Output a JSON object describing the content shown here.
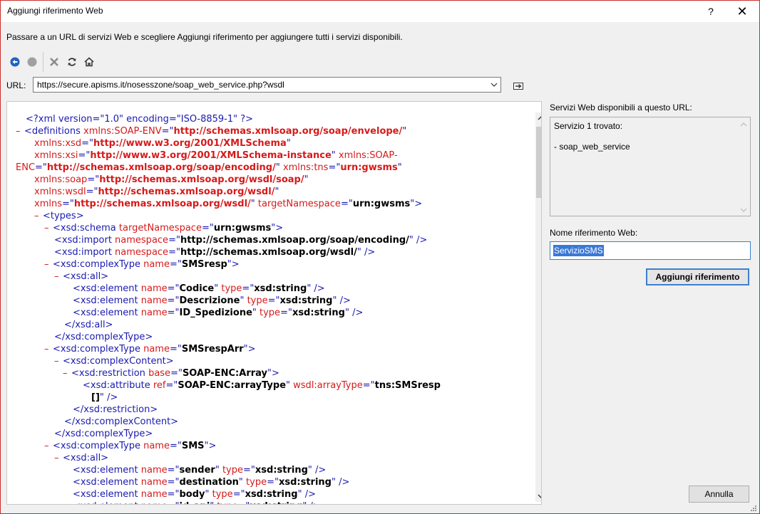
{
  "window": {
    "title": "Aggiungi riferimento Web",
    "help": "?",
    "close": "✕"
  },
  "instruction": "Passare a un URL di servizi Web e scegliere Aggiungi riferimento per aggiungere tutti i servizi disponibili.",
  "toolbar": {
    "icons": [
      "back-icon",
      "stop-icon",
      "cancel-icon",
      "refresh-icon",
      "home-icon"
    ]
  },
  "url": {
    "label": "URL:",
    "value": "https://secure.apisms.it/nosesszone/soap_web_service.php?wsdl"
  },
  "services": {
    "label": "Servizi Web disponibili a questo URL:",
    "found": "Servizio 1 trovato:",
    "items": [
      "- soap_web_service"
    ]
  },
  "reference": {
    "label": "Nome riferimento Web:",
    "value": "ServizioSMS"
  },
  "buttons": {
    "add": "Aggiungi riferimento",
    "cancel": "Annulla"
  },
  "xml": {
    "lines": [
      [
        [
          "t",
          "<?xml version=\"1.0\" encoding=\"ISO-8859-1\" ?>"
        ]
      ],
      [
        [
          "m",
          "–"
        ],
        [
          "t",
          "<definitions "
        ],
        [
          "an",
          "xmlns:SOAP-ENV"
        ],
        [
          "t",
          "=\""
        ],
        [
          "rv",
          "http://schemas.xmlsoap.org/soap/envelope/"
        ],
        [
          "t",
          "\""
        ]
      ],
      [
        [
          "an",
          "xmlns:xsd"
        ],
        [
          "t",
          "=\""
        ],
        [
          "rv",
          "http://www.w3.org/2001/XMLSchema"
        ],
        [
          "t",
          "\""
        ]
      ],
      [
        [
          "an",
          "xmlns:xsi"
        ],
        [
          "t",
          "=\""
        ],
        [
          "rv",
          "http://www.w3.org/2001/XMLSchema-instance"
        ],
        [
          "t",
          "\" "
        ],
        [
          "an",
          "xmlns:SOAP-"
        ]
      ],
      [
        [
          "an",
          "ENC"
        ],
        [
          "t",
          "=\""
        ],
        [
          "rv",
          "http://schemas.xmlsoap.org/soap/encoding/"
        ],
        [
          "t",
          "\" "
        ],
        [
          "an",
          "xmlns:tns"
        ],
        [
          "t",
          "=\""
        ],
        [
          "rv",
          "urn:gwsms"
        ],
        [
          "t",
          "\""
        ]
      ],
      [
        [
          "an",
          "xmlns:soap"
        ],
        [
          "t",
          "=\""
        ],
        [
          "rv",
          "http://schemas.xmlsoap.org/wsdl/soap/"
        ],
        [
          "t",
          "\""
        ]
      ],
      [
        [
          "an",
          "xmlns:wsdl"
        ],
        [
          "t",
          "=\""
        ],
        [
          "rv",
          "http://schemas.xmlsoap.org/wsdl/"
        ],
        [
          "t",
          "\""
        ]
      ],
      [
        [
          "an",
          "xmlns"
        ],
        [
          "t",
          "=\""
        ],
        [
          "rv",
          "http://schemas.xmlsoap.org/wsdl/"
        ],
        [
          "t",
          "\" "
        ],
        [
          "an",
          "targetNamespace"
        ],
        [
          "t",
          "=\""
        ],
        [
          "av",
          "urn:gwsms"
        ],
        [
          "t",
          "\">"
        ]
      ],
      [
        [
          "m",
          "–"
        ],
        [
          "t",
          "<types>"
        ]
      ],
      [
        [
          "m",
          "–"
        ],
        [
          "t",
          "<xsd:schema "
        ],
        [
          "an",
          "targetNamespace"
        ],
        [
          "t",
          "=\""
        ],
        [
          "av",
          "urn:gwsms"
        ],
        [
          "t",
          "\">"
        ]
      ],
      [
        [
          "t",
          "<xsd:import "
        ],
        [
          "an",
          "namespace"
        ],
        [
          "t",
          "=\""
        ],
        [
          "av",
          "http://schemas.xmlsoap.org/soap/encoding/"
        ],
        [
          "t",
          "\" />"
        ]
      ],
      [
        [
          "t",
          "<xsd:import "
        ],
        [
          "an",
          "namespace"
        ],
        [
          "t",
          "=\""
        ],
        [
          "av",
          "http://schemas.xmlsoap.org/wsdl/"
        ],
        [
          "t",
          "\" />"
        ]
      ],
      [
        [
          "m",
          "–"
        ],
        [
          "t",
          "<xsd:complexType "
        ],
        [
          "an",
          "name"
        ],
        [
          "t",
          "=\""
        ],
        [
          "av",
          "SMSresp"
        ],
        [
          "t",
          "\">"
        ]
      ],
      [
        [
          "m",
          "–"
        ],
        [
          "t",
          "<xsd:all>"
        ]
      ],
      [
        [
          "t",
          "<xsd:element "
        ],
        [
          "an",
          "name"
        ],
        [
          "t",
          "=\""
        ],
        [
          "av",
          "Codice"
        ],
        [
          "t",
          "\" "
        ],
        [
          "an",
          "type"
        ],
        [
          "t",
          "=\""
        ],
        [
          "av",
          "xsd:string"
        ],
        [
          "t",
          "\" />"
        ]
      ],
      [
        [
          "t",
          "<xsd:element "
        ],
        [
          "an",
          "name"
        ],
        [
          "t",
          "=\""
        ],
        [
          "av",
          "Descrizione"
        ],
        [
          "t",
          "\" "
        ],
        [
          "an",
          "type"
        ],
        [
          "t",
          "=\""
        ],
        [
          "av",
          "xsd:string"
        ],
        [
          "t",
          "\" />"
        ]
      ],
      [
        [
          "t",
          "<xsd:element "
        ],
        [
          "an",
          "name"
        ],
        [
          "t",
          "=\""
        ],
        [
          "av",
          "ID_Spedizione"
        ],
        [
          "t",
          "\" "
        ],
        [
          "an",
          "type"
        ],
        [
          "t",
          "=\""
        ],
        [
          "av",
          "xsd:string"
        ],
        [
          "t",
          "\" />"
        ]
      ],
      [
        [
          "t",
          "</xsd:all>"
        ]
      ],
      [
        [
          "t",
          "</xsd:complexType>"
        ]
      ],
      [
        [
          "m",
          "–"
        ],
        [
          "t",
          "<xsd:complexType "
        ],
        [
          "an",
          "name"
        ],
        [
          "t",
          "=\""
        ],
        [
          "av",
          "SMSrespArr"
        ],
        [
          "t",
          "\">"
        ]
      ],
      [
        [
          "m",
          "–"
        ],
        [
          "t",
          "<xsd:complexContent>"
        ]
      ],
      [
        [
          "m",
          "–"
        ],
        [
          "t",
          "<xsd:restriction "
        ],
        [
          "an",
          "base"
        ],
        [
          "t",
          "=\""
        ],
        [
          "av",
          "SOAP-ENC:Array"
        ],
        [
          "t",
          "\">"
        ]
      ],
      [
        [
          "t",
          "<xsd:attribute "
        ],
        [
          "an",
          "ref"
        ],
        [
          "t",
          "=\""
        ],
        [
          "av",
          "SOAP-ENC:arrayType"
        ],
        [
          "t",
          "\" "
        ],
        [
          "an",
          "wsdl:arrayType"
        ],
        [
          "t",
          "=\""
        ],
        [
          "av",
          "tns:SMSresp"
        ]
      ],
      [
        [
          "av",
          "[]"
        ],
        [
          "t",
          "\" />"
        ]
      ],
      [
        [
          "t",
          "</xsd:restriction>"
        ]
      ],
      [
        [
          "t",
          "</xsd:complexContent>"
        ]
      ],
      [
        [
          "t",
          "</xsd:complexType>"
        ]
      ],
      [
        [
          "m",
          "–"
        ],
        [
          "t",
          "<xsd:complexType "
        ],
        [
          "an",
          "name"
        ],
        [
          "t",
          "=\""
        ],
        [
          "av",
          "SMS"
        ],
        [
          "t",
          "\">"
        ]
      ],
      [
        [
          "m",
          "–"
        ],
        [
          "t",
          "<xsd:all>"
        ]
      ],
      [
        [
          "t",
          "<xsd:element "
        ],
        [
          "an",
          "name"
        ],
        [
          "t",
          "=\""
        ],
        [
          "av",
          "sender"
        ],
        [
          "t",
          "\" "
        ],
        [
          "an",
          "type"
        ],
        [
          "t",
          "=\""
        ],
        [
          "av",
          "xsd:string"
        ],
        [
          "t",
          "\" />"
        ]
      ],
      [
        [
          "t",
          "<xsd:element "
        ],
        [
          "an",
          "name"
        ],
        [
          "t",
          "=\""
        ],
        [
          "av",
          "destination"
        ],
        [
          "t",
          "\" "
        ],
        [
          "an",
          "type"
        ],
        [
          "t",
          "=\""
        ],
        [
          "av",
          "xsd:string"
        ],
        [
          "t",
          "\" />"
        ]
      ],
      [
        [
          "t",
          "<xsd:element "
        ],
        [
          "an",
          "name"
        ],
        [
          "t",
          "=\""
        ],
        [
          "av",
          "body"
        ],
        [
          "t",
          "\" "
        ],
        [
          "an",
          "type"
        ],
        [
          "t",
          "=\""
        ],
        [
          "av",
          "xsd:string"
        ],
        [
          "t",
          "\" />"
        ]
      ],
      [
        [
          "t",
          "<xsd:element "
        ],
        [
          "an",
          "name"
        ],
        [
          "t",
          "=\""
        ],
        [
          "av",
          "id_api"
        ],
        [
          "t",
          "\" "
        ],
        [
          "an",
          "type"
        ],
        [
          "t",
          "=\""
        ],
        [
          "av",
          "xsd:string"
        ],
        [
          "t",
          "\" />"
        ]
      ]
    ]
  }
}
